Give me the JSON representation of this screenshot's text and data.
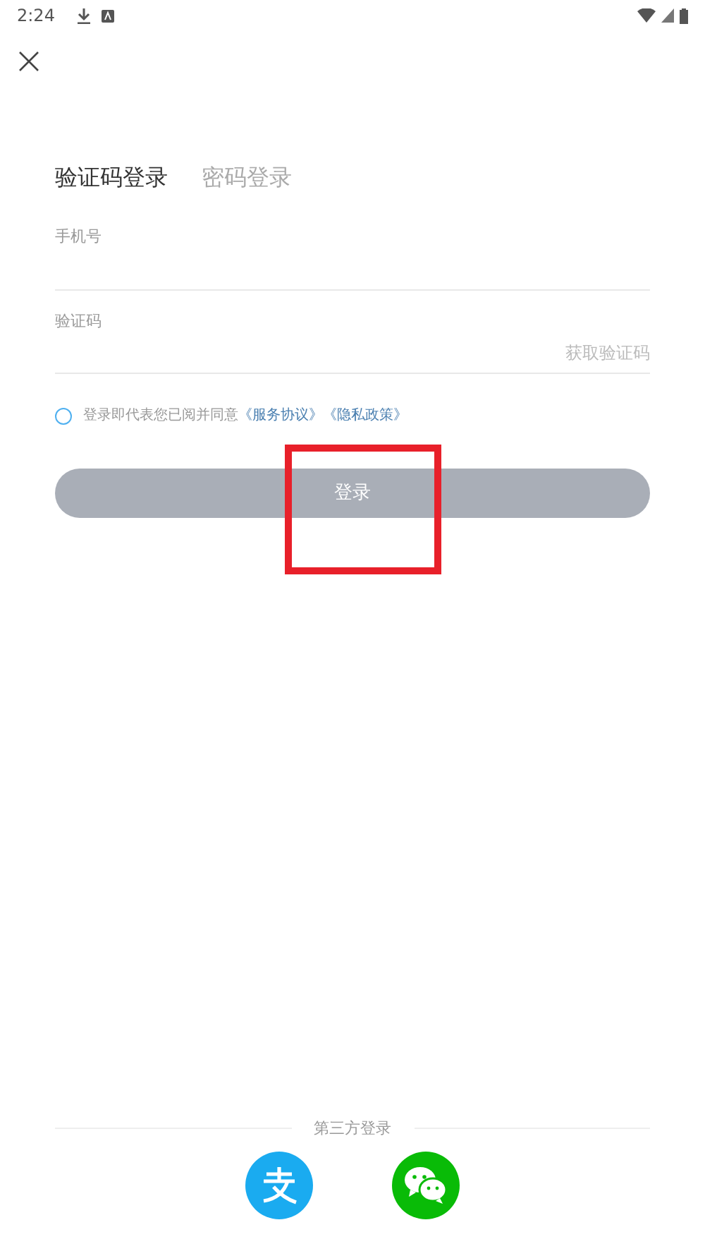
{
  "status_bar": {
    "time": "2:24"
  },
  "tabs": [
    {
      "label": "验证码登录",
      "selected": true
    },
    {
      "label": "密码登录",
      "selected": false
    }
  ],
  "fields": [
    {
      "label": "手机号"
    },
    {
      "label": "验证码",
      "action": "获取验证码"
    }
  ],
  "agreement": {
    "checked": false,
    "text": "登录即代表您已阅并同意",
    "links": [
      "《服务协议》",
      "《隐私政策》"
    ]
  },
  "login_button": {
    "label": "登录",
    "disabled": true
  },
  "highlight": {
    "color": "#e8202a"
  },
  "third_party": {
    "title": "第三方登录",
    "providers": [
      {
        "kind": "alipay",
        "color": "#1aabf0"
      },
      {
        "kind": "wechat",
        "color": "#09bb07"
      }
    ]
  }
}
